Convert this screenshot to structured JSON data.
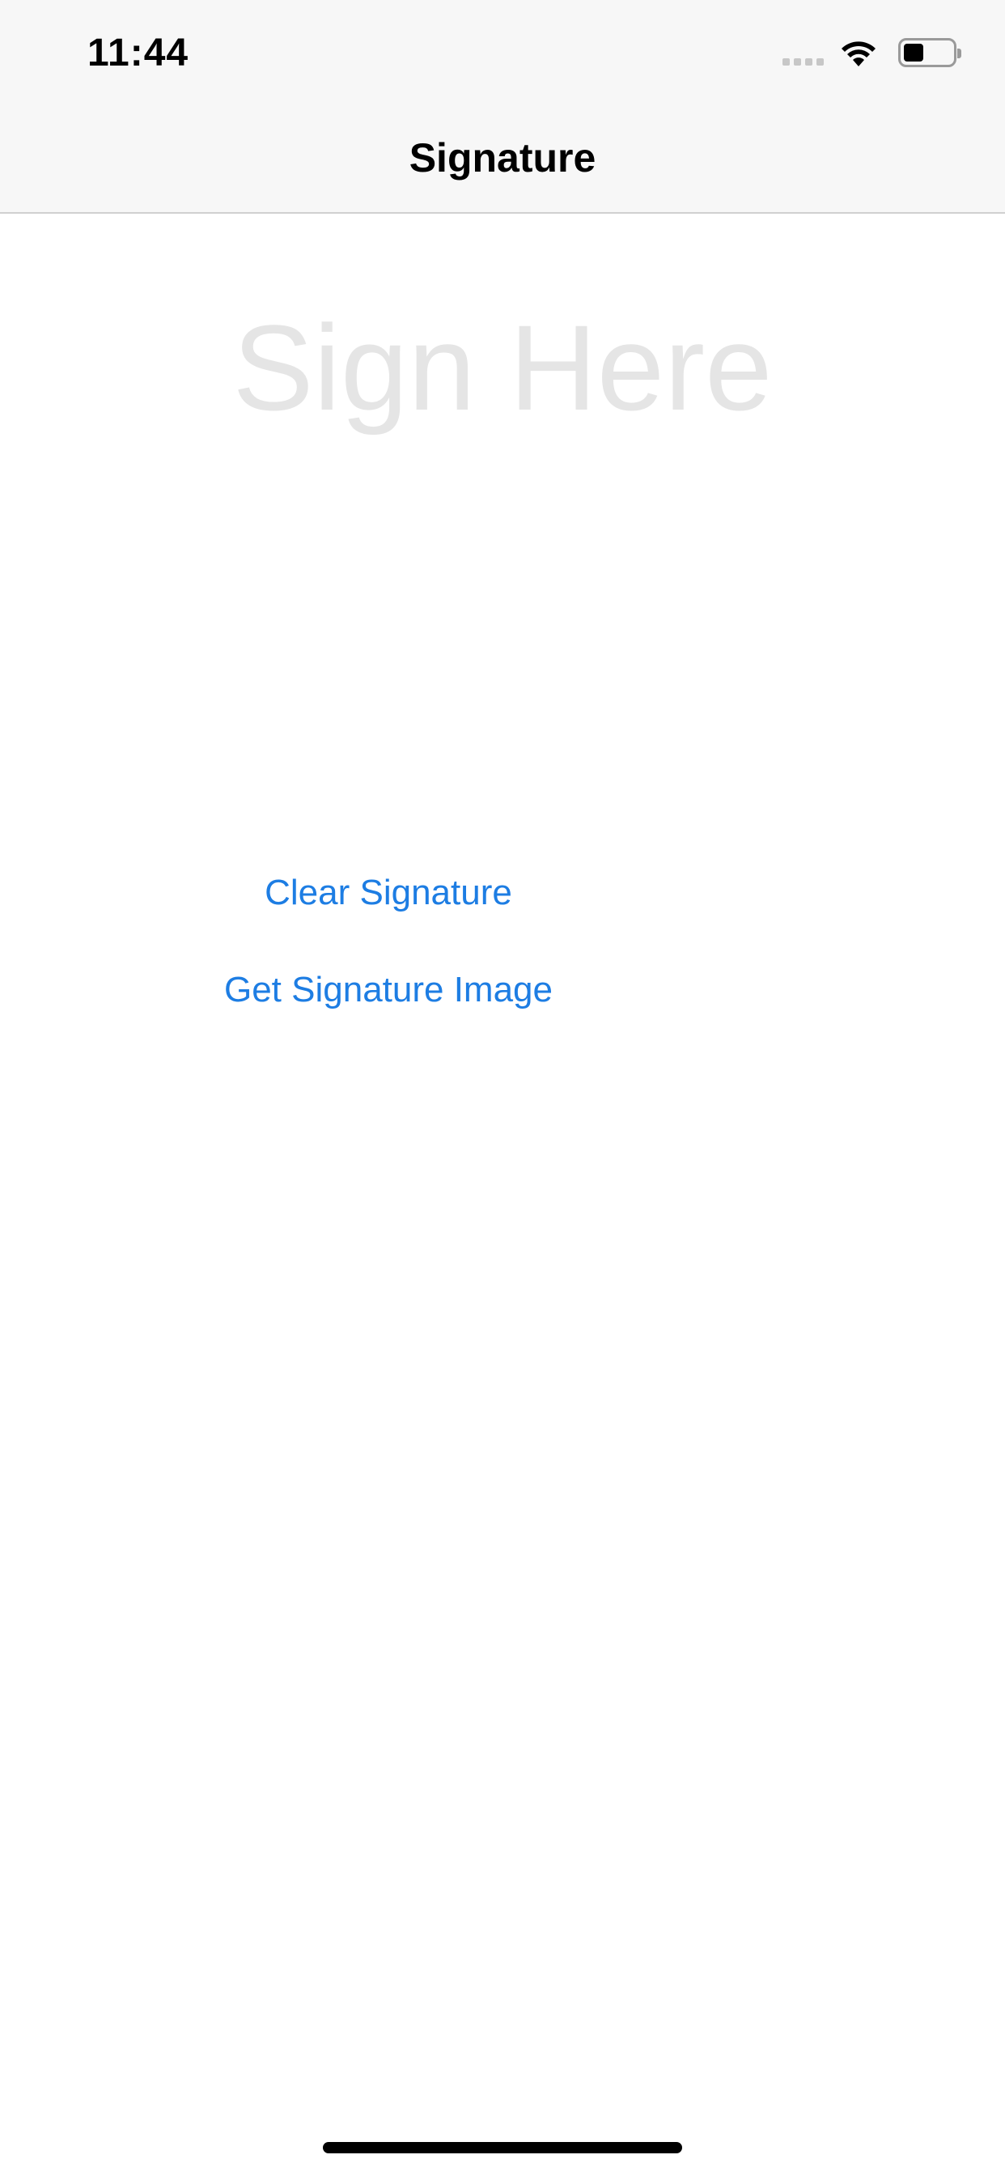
{
  "status_bar": {
    "time": "11:44",
    "icons": [
      "cellular-signal-icon",
      "wifi-icon",
      "battery-icon"
    ],
    "battery_level": 0.4
  },
  "nav": {
    "title": "Signature"
  },
  "signature_pad": {
    "placeholder": "Sign Here",
    "placeholder_color": "#e5e5e5"
  },
  "actions": {
    "clear_label": "Clear Signature",
    "get_image_label": "Get Signature Image",
    "link_color": "#1d7de3"
  }
}
